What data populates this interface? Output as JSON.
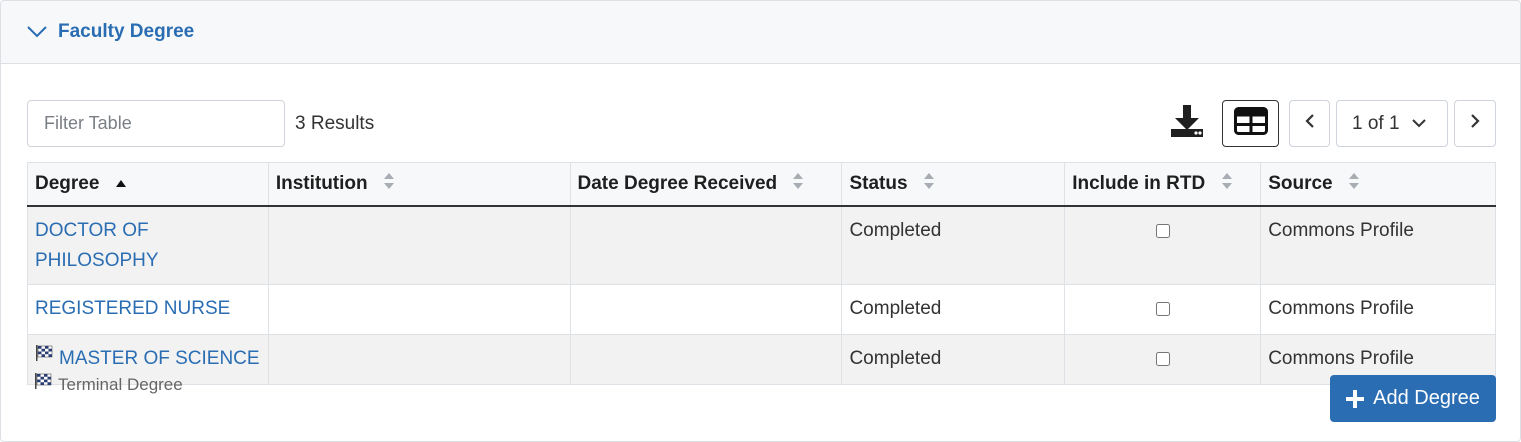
{
  "section": {
    "title": "Faculty Degree",
    "chevron_icon": "chevron-down-icon"
  },
  "toolbar": {
    "filter_placeholder": "Filter Table",
    "results_text": "3 Results",
    "download_icon": "download-icon",
    "layout_icon": "table-layout-icon",
    "pagination": {
      "current": "1 of 1",
      "prev_icon": "chevron-left-icon",
      "next_icon": "chevron-right-icon"
    }
  },
  "table": {
    "columns": [
      {
        "label": "Degree",
        "sort": "ascending"
      },
      {
        "label": "Institution",
        "sort": "none"
      },
      {
        "label": "Date Degree Received",
        "sort": "none"
      },
      {
        "label": "Status",
        "sort": "none"
      },
      {
        "label": "Include in RTD",
        "sort": "none"
      },
      {
        "label": "Source",
        "sort": "none"
      }
    ],
    "rows": [
      {
        "degree_line1": "DOCTOR OF",
        "degree_line2": "PHILOSOPHY",
        "institution": "",
        "date": "",
        "status": "Completed",
        "include_rtd": false,
        "source": "Commons Profile",
        "terminal": false
      },
      {
        "degree": "REGISTERED NURSE",
        "institution": "",
        "date": "",
        "status": "Completed",
        "include_rtd": false,
        "source": "Commons Profile",
        "terminal": false
      },
      {
        "degree": "MASTER OF SCIENCE",
        "institution": "",
        "date": "",
        "status": "Completed",
        "include_rtd": false,
        "source": "Commons Profile",
        "terminal": true
      }
    ]
  },
  "legend": {
    "icon": "checkered-flag-icon",
    "label": "Terminal Degree"
  },
  "add_button": {
    "label": "Add Degree",
    "icon": "plus-icon"
  },
  "colors": {
    "link": "#2a6db3",
    "primary_button": "#2a6db3",
    "header_bg": "#f6f8fa",
    "odd_row_bg": "#f2f2f2"
  }
}
